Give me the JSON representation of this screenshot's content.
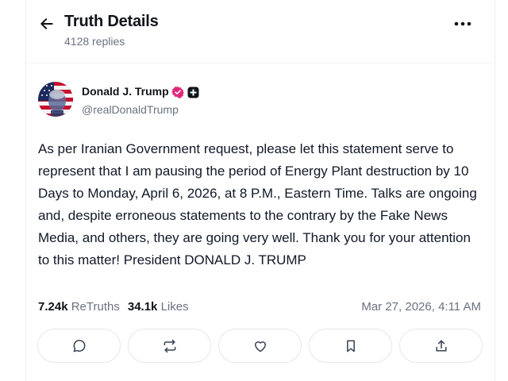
{
  "header": {
    "title": "Truth Details",
    "reply_count": "4128 replies",
    "back_icon": "arrow-left-icon",
    "more_icon": "more-horizontal-icon"
  },
  "post": {
    "author": {
      "name": "Donald J. Trump",
      "handle": "@realDonaldTrump",
      "verified_color": "#e0267b"
    },
    "text": "As per Iranian Government request, please let this statement serve to represent that I am pausing the period of Energy Plant destruction by 10 Days to Monday, April 6, 2026, at 8 P.M., Eastern Time. Talks are ongoing and, despite erroneous statements to the contrary by the Fake News Media, and others, they are going very well. Thank you for your attention to this matter! President DONALD J. TRUMP",
    "retruths_count": "7.24k",
    "retruths_label": "ReTruths",
    "likes_count": "34.1k",
    "likes_label": "Likes",
    "timestamp": "Mar 27, 2026, 4:11 AM"
  },
  "actions": [
    {
      "icon": "reply-icon"
    },
    {
      "icon": "retruth-icon"
    },
    {
      "icon": "like-icon"
    },
    {
      "icon": "bookmark-icon"
    },
    {
      "icon": "share-icon"
    }
  ]
}
